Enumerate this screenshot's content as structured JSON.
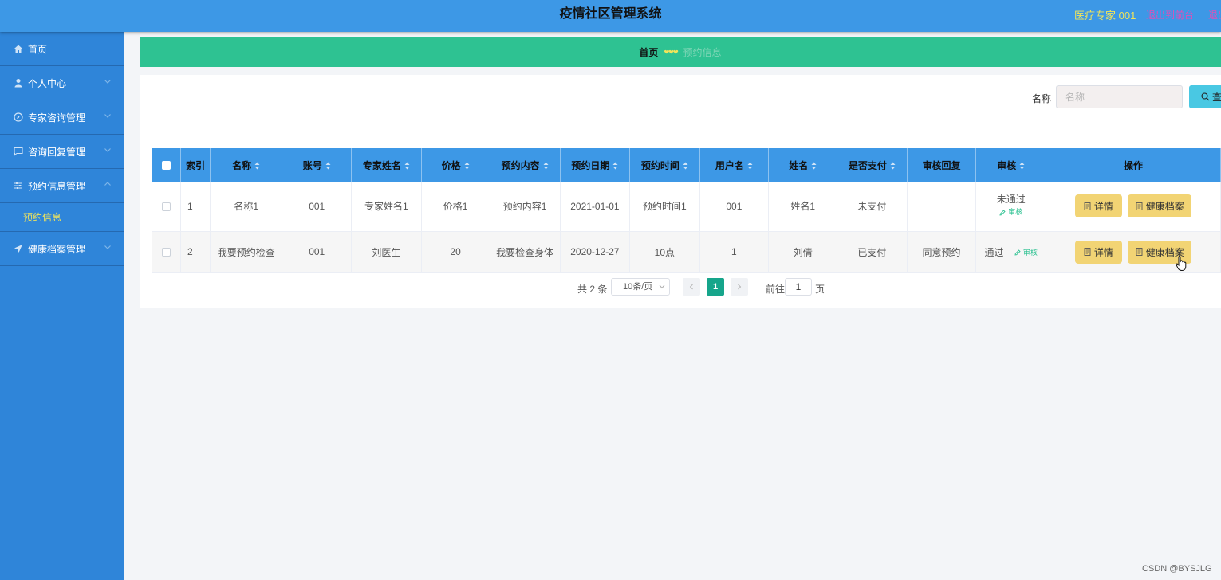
{
  "header": {
    "title": "疫情社区管理系统",
    "role_text": "医疗专家 001",
    "back_front": "退出到前台",
    "logout": "退出登录"
  },
  "sidebar": {
    "items": [
      {
        "label": "首页",
        "icon": "home-icon",
        "has_children": false
      },
      {
        "label": "个人中心",
        "icon": "user-icon",
        "has_children": true
      },
      {
        "label": "专家咨询管理",
        "icon": "compass-icon",
        "has_children": true
      },
      {
        "label": "咨询回复管理",
        "icon": "message-icon",
        "has_children": true
      },
      {
        "label": "预约信息管理",
        "icon": "sliders-icon",
        "has_children": true,
        "expanded": true,
        "children": [
          {
            "label": "预约信息",
            "active": true
          }
        ]
      },
      {
        "label": "健康档案管理",
        "icon": "send-icon",
        "has_children": true
      }
    ]
  },
  "breadcrumb": {
    "home": "首页",
    "current": "预约信息"
  },
  "search": {
    "label": "名称",
    "placeholder": "名称",
    "button": "查询"
  },
  "table": {
    "headers": [
      "索引",
      "名称",
      "账号",
      "专家姓名",
      "价格",
      "预约内容",
      "预约日期",
      "预约时间",
      "用户名",
      "姓名",
      "是否支付",
      "审核回复",
      "审核",
      "操作"
    ],
    "rows": [
      {
        "index": "1",
        "name": "名称1",
        "account": "001",
        "expert": "专家姓名1",
        "price": "价格1",
        "content": "预约内容1",
        "date": "2021-01-01",
        "time": "预约时间1",
        "username": "001",
        "realname": "姓名1",
        "paid": "未支付",
        "reply": "",
        "status": "未通过",
        "audit_link": "审核"
      },
      {
        "index": "2",
        "name": "我要预约检查",
        "account": "001",
        "expert": "刘医生",
        "price": "20",
        "content": "我要检查身体",
        "date": "2020-12-27",
        "time": "10点",
        "username": "1",
        "realname": "刘倩",
        "paid": "已支付",
        "reply": "同意预约",
        "status": "通过",
        "audit_link": "审核"
      }
    ],
    "actions": {
      "detail": "详情",
      "record": "健康档案"
    }
  },
  "pagination": {
    "total": "共 2 条",
    "page_size": "10条/页",
    "current": "1",
    "goto_label": "前往",
    "goto_value": "1",
    "page_suffix": "页"
  },
  "watermark": "CSDN @BYSJLG",
  "colors": {
    "header": "#3d98e6",
    "sidebar": "#2f85d9",
    "breadcrumb": "#2ec292",
    "active_menu": "#f1e45a",
    "action_button": "#f2d474",
    "pager_active": "#16a58b"
  }
}
